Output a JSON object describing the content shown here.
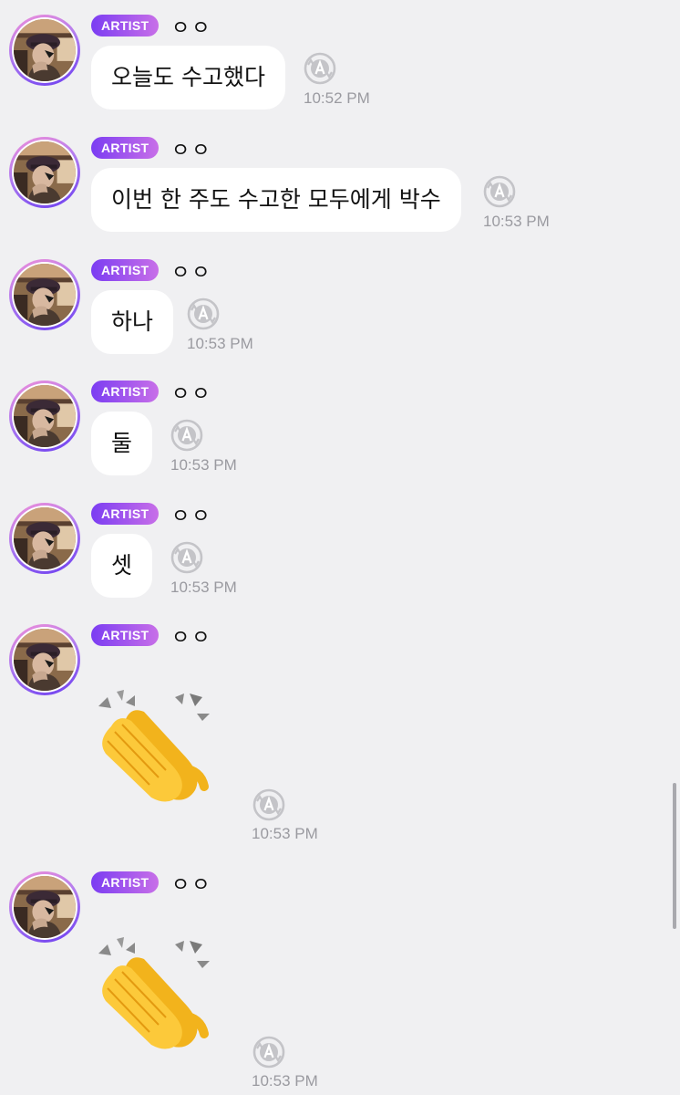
{
  "messages": [
    {
      "badge": "ARTIST",
      "name": "ㅇㅇ",
      "text": "오늘도 수고했다",
      "time": "10:52 PM",
      "translate_icon": "translate-icon"
    },
    {
      "badge": "ARTIST",
      "name": "ㅇㅇ",
      "text": "이번 한 주도 수고한 모두에게 박수",
      "time": "10:53 PM",
      "translate_icon": "translate-icon"
    },
    {
      "badge": "ARTIST",
      "name": "ㅇㅇ",
      "text": "하나",
      "time": "10:53 PM",
      "translate_icon": "translate-icon"
    },
    {
      "badge": "ARTIST",
      "name": "ㅇㅇ",
      "text": "둘",
      "time": "10:53 PM",
      "translate_icon": "translate-icon"
    },
    {
      "badge": "ARTIST",
      "name": "ㅇㅇ",
      "text": "셋",
      "time": "10:53 PM",
      "translate_icon": "translate-icon"
    },
    {
      "badge": "ARTIST",
      "name": "ㅇㅇ",
      "emoji": "clapping-hands-emoji",
      "time": "10:53 PM",
      "translate_icon": "translate-icon"
    },
    {
      "badge": "ARTIST",
      "name": "ㅇㅇ",
      "emoji": "clapping-hands-emoji",
      "time": "10:53 PM",
      "translate_icon": "translate-icon"
    }
  ],
  "colors": {
    "background": "#f0f0f2",
    "bubble": "#ffffff",
    "badge_start": "#7b3df2",
    "badge_end": "#c86fe8",
    "time": "#9a9aa0"
  }
}
